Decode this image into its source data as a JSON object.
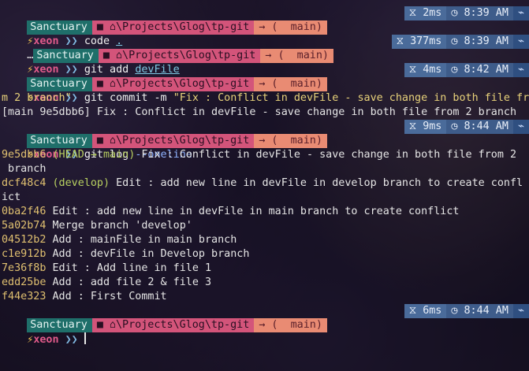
{
  "prompt_user": "xeon",
  "prompt_symbol": "⚡",
  "prompt_chevron": "❯❯",
  "status_bars": [
    {
      "host": "Sanctuary",
      "path": "⌂\\Projects\\Glog\\tp-git",
      "branch": "→ (  main)",
      "duration": "2ms",
      "time": "8:39 AM",
      "prefix": ""
    },
    {
      "host": "Sanctuary",
      "path": "⌂\\Projects\\Glog\\tp-git",
      "branch": "→ (  main)",
      "duration": "377ms",
      "time": "8:39 AM",
      "prefix": "…"
    },
    {
      "host": "Sanctuary",
      "path": "⌂\\Projects\\Glog\\tp-git",
      "branch": "→ (  main)",
      "duration": "4ms",
      "time": "8:42 AM",
      "prefix": ""
    },
    {
      "host": "Sanctuary",
      "path": "⌂\\Projects\\Glog\\tp-git",
      "branch": "→ (  main)",
      "duration": "9ms",
      "time": "8:44 AM",
      "prefix": ""
    },
    {
      "host": "Sanctuary",
      "path": "⌂\\Projects\\Glog\\tp-git",
      "branch": "→ (  main)",
      "duration": "6ms",
      "time": "8:44 AM",
      "prefix": ""
    }
  ],
  "commands": [
    {
      "cmd": "code",
      "arg": "."
    },
    {
      "cmd": "git add",
      "arg": "devFile"
    },
    {
      "cmd": "git commit -m",
      "arg": "\"Fix : Conflict in devFile - save change in both file fro"
    },
    {
      "cmd": "git log",
      "arg": "--oneline"
    }
  ],
  "commit_wrap": "m 2 branch\"",
  "commit_result": "[main 9e5dbb6] Fix : Conflict in devFile - save change in both file from 2 branch",
  "log": [
    {
      "hash": "9e5dbb6",
      "refs": "(HEAD → main)",
      "msg": "Fix : Conflict in devFile - save change in both file from 2",
      "wrap": " branch"
    },
    {
      "hash": "dcf48c4",
      "refs": "(develop)",
      "msg": "Edit : add new line in devFile in develop branch to create confl",
      "wrap": "ict"
    },
    {
      "hash": "0ba2f46",
      "refs": "",
      "msg": "Edit : add new line in devFile in main branch to create conflict",
      "wrap": ""
    },
    {
      "hash": "5a02b74",
      "refs": "",
      "msg": "Merge branch 'develop'",
      "wrap": ""
    },
    {
      "hash": "04512b2",
      "refs": "",
      "msg": "Add : mainFile in main branch",
      "wrap": ""
    },
    {
      "hash": "c1e912b",
      "refs": "",
      "msg": "Add : devFile in Develop branch",
      "wrap": ""
    },
    {
      "hash": "7e36f8b",
      "refs": "",
      "msg": "Edit : Add line in file 1",
      "wrap": ""
    },
    {
      "hash": "edd25be",
      "refs": "",
      "msg": "Add : add file 2 & file 3",
      "wrap": ""
    },
    {
      "hash": "f44e323",
      "refs": "",
      "msg": "Add : First Commit",
      "wrap": ""
    }
  ],
  "icons": {
    "folder": "■",
    "duration": "⧖",
    "clock": "◷",
    "end": "⌁"
  }
}
